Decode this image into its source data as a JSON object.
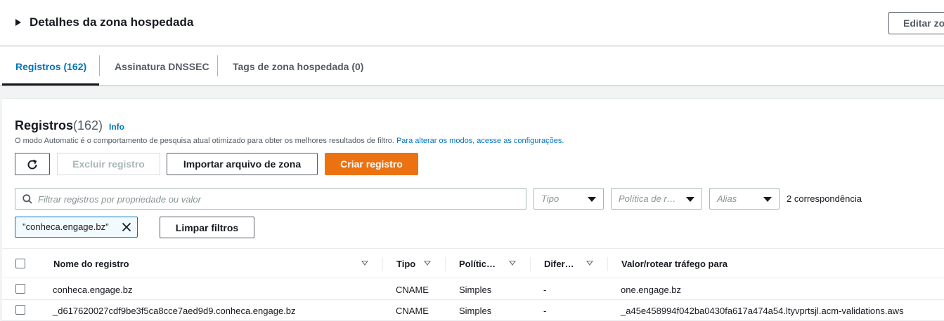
{
  "details": {
    "title": "Detalhes da zona hospedada",
    "edit_label": "Editar zo"
  },
  "tabs": [
    {
      "label": "Registros (162)",
      "active": true
    },
    {
      "label": "Assinatura DNSSEC",
      "active": false
    },
    {
      "label": "Tags de zona hospedada (0)",
      "active": false
    }
  ],
  "records": {
    "title": "Registros",
    "count": "(162)",
    "info_label": "Info",
    "description": "O modo Automatic é o comportamento de pesquisa atual otimizado para obter os melhores resultados de filtro.",
    "description_link": "Para alterar os modos, acesse as configurações.",
    "buttons": {
      "delete": "Excluir registro",
      "import": "Importar arquivo de zona",
      "create": "Criar registro",
      "clear_filters": "Limpar filtros"
    },
    "search_placeholder": "Filtrar registros por propriedade ou valor",
    "filters": {
      "type": "Tipo",
      "policy": "Política de r…",
      "alias": "Alias"
    },
    "matches": "2 correspondência",
    "token": "\"conheca.engage.bz\""
  },
  "table": {
    "headers": {
      "name": "Nome do registro",
      "type": "Tipo",
      "policy": "Polític…",
      "diff": "Difer…",
      "value": "Valor/rotear tráfego para"
    },
    "rows": [
      {
        "name": "conheca.engage.bz",
        "type": "CNAME",
        "policy": "Simples",
        "diff": "-",
        "value": "one.engage.bz"
      },
      {
        "name": "_d617620027cdf9be3f5ca8cce7aed9d9.conheca.engage.bz",
        "type": "CNAME",
        "policy": "Simples",
        "diff": "-",
        "value": "_a45e458994f042ba0430fa617a474a54.ltyvprtsjl.acm-validations.aws"
      }
    ]
  },
  "colors": {
    "accent_link": "#0073bb",
    "primary_button": "#ec7211",
    "text": "#16191f",
    "muted": "#545b64"
  }
}
